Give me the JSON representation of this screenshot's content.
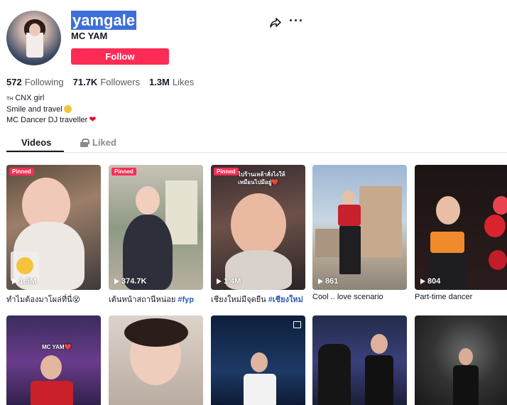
{
  "profile": {
    "username": "yamgale",
    "nickname": "MC YAM",
    "follow_label": "Follow",
    "stats": {
      "following_count": "572",
      "following_label": "Following",
      "followers_count": "71.7K",
      "followers_label": "Followers",
      "likes_count": "1.3M",
      "likes_label": "Likes"
    },
    "bio": {
      "line1_flag": "TH",
      "line1": "CNX girl",
      "line2": "Smile and travel",
      "line3": "MC Dancer DJ traveller"
    }
  },
  "tabs": {
    "videos": "Videos",
    "liked": "Liked"
  },
  "videos": [
    {
      "pinned": "Pinned",
      "views": "1.9M",
      "caption": "ทำไมต้องมาโผล่ที่นี่😵",
      "hashtag": ""
    },
    {
      "pinned": "Pinned",
      "views": "374.7K",
      "caption": "เต้นหน้าสถานีหน่อย ",
      "hashtag": "#fyp"
    },
    {
      "pinned": "Pinned",
      "views": "1.4M",
      "caption": "เชียงใหม่มีจุดยืน ",
      "hashtag": "#เชียงใหม่",
      "overlay": "ไปร้านเหล้าสั่งไงให้เหมือนไปมีอยู่❤️"
    },
    {
      "pinned": "",
      "views": "861",
      "caption": "Cool .. love scenario",
      "hashtag": ""
    },
    {
      "pinned": "",
      "views": "804",
      "caption": "Part-time dancer",
      "hashtag": ""
    },
    {
      "overlay": "MC YAM❤️"
    },
    {},
    {},
    {},
    {}
  ],
  "colors": {
    "accent": "#fe2c55",
    "hashtag": "#2b5db9",
    "username_highlight": "#3d6fd8"
  }
}
